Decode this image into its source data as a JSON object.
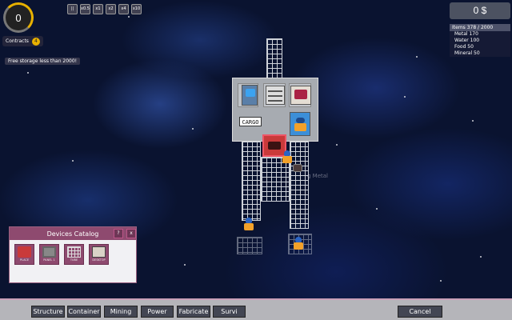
{
  "hud": {
    "contracts_count": "0",
    "contracts_label": "Contracts",
    "contracts_badge": "4",
    "notice": "Free storage less than 2000!",
    "speed_buttons": [
      "||",
      "x0.5",
      "x1",
      "x2",
      "x4",
      "x10"
    ]
  },
  "money": {
    "value": "0 $"
  },
  "resources": {
    "header": "Items 378 / 2000",
    "items": [
      "Metal 170",
      "Water 100",
      "Food 50",
      "Mineral 50"
    ]
  },
  "station": {
    "cargo_label": "CARGO",
    "ghost_text": "g Metal"
  },
  "catalog": {
    "title": "Devices Catalog",
    "help": "?",
    "close": "x",
    "items": [
      {
        "label": "PLACE"
      },
      {
        "label": "PANEL 1"
      },
      {
        "label": "TUBE"
      },
      {
        "label": "DESKTOP"
      }
    ]
  },
  "bottom": {
    "tabs": [
      "Structure",
      "Container",
      "Mining",
      "Power",
      "Fabricate",
      "Survi"
    ],
    "cancel": "Cancel"
  },
  "colors": {
    "accent": "#8e4a6f",
    "contracts_ring": "#e8b100",
    "toolbar": "#434653"
  }
}
